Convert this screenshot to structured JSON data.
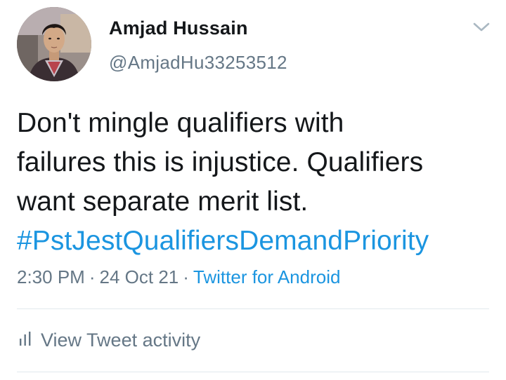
{
  "author": {
    "display_name": "Amjad Hussain",
    "handle": "@AmjadHu33253512"
  },
  "tweet": {
    "text_lines": [
      "Don't mingle qualifiers with",
      "failures this is injustice. Qualifiers",
      "want separate merit list."
    ],
    "hashtag": "#PstJestQualifiersDemandPriority",
    "time": "2:30 PM",
    "separator": "·",
    "date": "24 Oct 21",
    "source": "Twitter for Android"
  },
  "actions": {
    "activity_label": "View Tweet activity"
  },
  "icons": {
    "menu": "chevron-down-icon",
    "activity": "bar-chart-icon"
  },
  "colors": {
    "link": "#1b95e0",
    "secondary_text": "#657786",
    "primary_text": "#14171a",
    "divider": "#e1e8ed"
  }
}
